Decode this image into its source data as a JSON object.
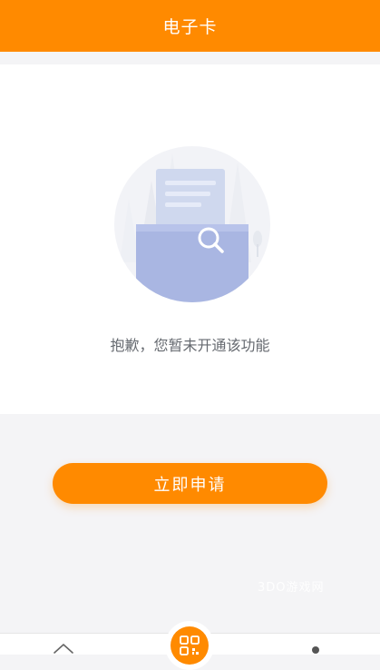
{
  "header": {
    "title": "电子卡"
  },
  "empty_state": {
    "illustration": "empty-folder-search-icon",
    "message": "抱歉，您暂未开通该功能"
  },
  "actions": {
    "apply_label": "立即申请"
  },
  "watermark": "3DO游戏网",
  "tabbar": {
    "items": [
      {
        "icon": "home-icon"
      },
      {
        "icon": "qr-code-icon"
      },
      {
        "icon": "user-icon"
      }
    ]
  },
  "colors": {
    "accent": "#ff8a00",
    "page_background": "#f4f4f6",
    "card_background": "#ffffff",
    "message_text": "#666a70"
  }
}
